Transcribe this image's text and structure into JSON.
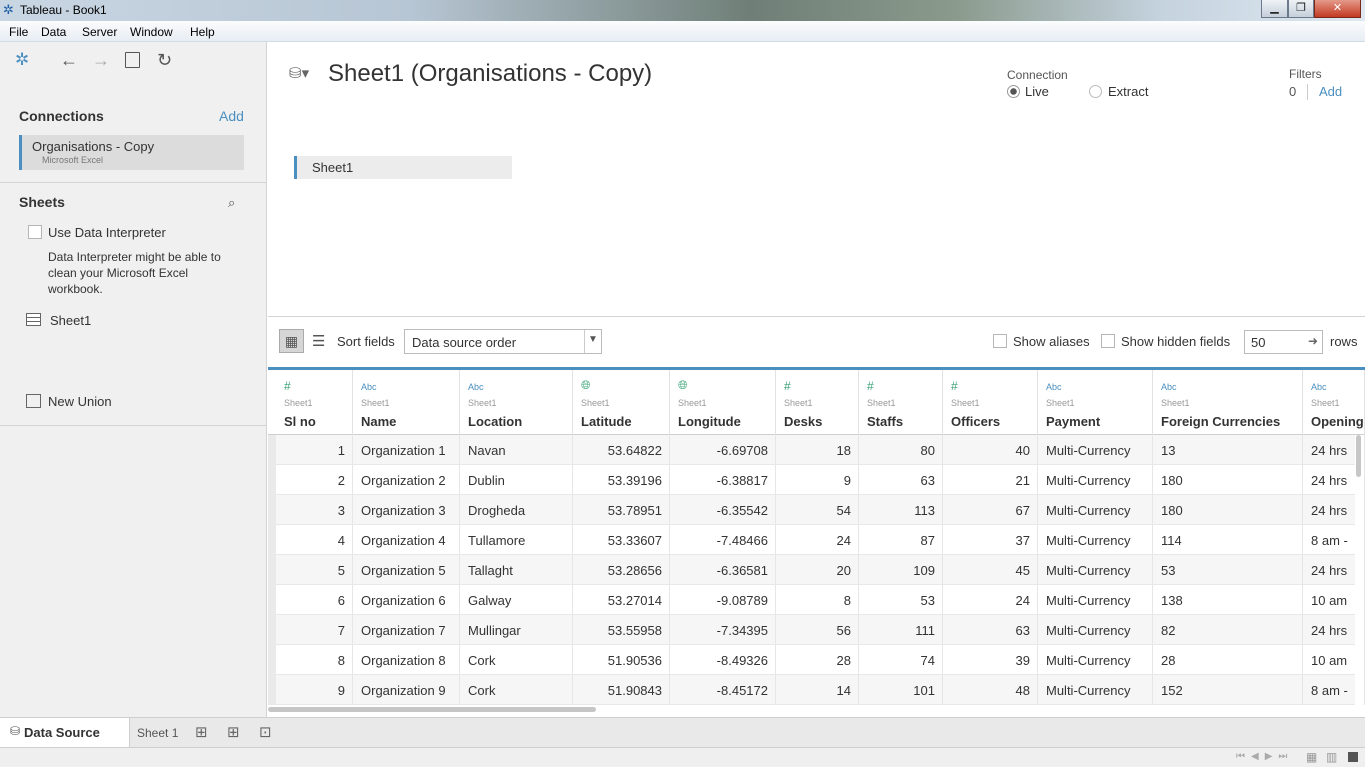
{
  "window": {
    "title": "Tableau - Book1"
  },
  "menu": [
    "File",
    "Data",
    "Server",
    "Window",
    "Help"
  ],
  "left": {
    "connections_title": "Connections",
    "connections_add": "Add",
    "connection": {
      "name": "Organisations - Copy",
      "type": "Microsoft Excel"
    },
    "sheets_title": "Sheets",
    "use_interpreter": "Use Data Interpreter",
    "interpreter_note": "Data Interpreter might be able to clean your Microsoft Excel workbook.",
    "sheet": "Sheet1",
    "new_union": "New Union"
  },
  "header": {
    "title": "Sheet1 (Organisations - Copy)",
    "connection_label": "Connection",
    "live": "Live",
    "extract": "Extract",
    "filters_label": "Filters",
    "filters_count": "0",
    "filters_add": "Add"
  },
  "canvas": {
    "sheet_pill": "Sheet1"
  },
  "toolbar": {
    "sort_label": "Sort fields",
    "sort_value": "Data source order",
    "show_aliases": "Show aliases",
    "show_hidden": "Show hidden fields",
    "rows_value": "50",
    "rows_label": "rows"
  },
  "grid": {
    "columns": [
      {
        "type": "#",
        "src": "Sheet1",
        "name": "Sl no"
      },
      {
        "type": "Abc",
        "src": "Sheet1",
        "name": "Name"
      },
      {
        "type": "Abc",
        "src": "Sheet1",
        "name": "Location"
      },
      {
        "type": "geo",
        "src": "Sheet1",
        "name": "Latitude"
      },
      {
        "type": "geo",
        "src": "Sheet1",
        "name": "Longitude"
      },
      {
        "type": "#",
        "src": "Sheet1",
        "name": "Desks"
      },
      {
        "type": "#",
        "src": "Sheet1",
        "name": "Staffs"
      },
      {
        "type": "#",
        "src": "Sheet1",
        "name": "Officers"
      },
      {
        "type": "Abc",
        "src": "Sheet1",
        "name": "Payment"
      },
      {
        "type": "Abc",
        "src": "Sheet1",
        "name": "Foreign Currencies"
      },
      {
        "type": "Abc",
        "src": "Sheet1",
        "name": "Opening H"
      }
    ],
    "rows": [
      [
        "1",
        "Organization 1",
        "Navan",
        "53.64822",
        "-6.69708",
        "18",
        "80",
        "40",
        "Multi-Currency",
        "13",
        "24 hrs"
      ],
      [
        "2",
        "Organization 2",
        "Dublin",
        "53.39196",
        "-6.38817",
        "9",
        "63",
        "21",
        "Multi-Currency",
        "180",
        "24 hrs"
      ],
      [
        "3",
        "Organization 3",
        "Drogheda",
        "53.78951",
        "-6.35542",
        "54",
        "113",
        "67",
        "Multi-Currency",
        "180",
        "24 hrs"
      ],
      [
        "4",
        "Organization 4",
        "Tullamore",
        "53.33607",
        "-7.48466",
        "24",
        "87",
        "37",
        "Multi-Currency",
        "114",
        "8 am -"
      ],
      [
        "5",
        "Organization 5",
        "Tallaght",
        "53.28656",
        "-6.36581",
        "20",
        "109",
        "45",
        "Multi-Currency",
        "53",
        "24 hrs"
      ],
      [
        "6",
        "Organization 6",
        "Galway",
        "53.27014",
        "-9.08789",
        "8",
        "53",
        "24",
        "Multi-Currency",
        "138",
        "10 am"
      ],
      [
        "7",
        "Organization 7",
        "Mullingar",
        "53.55958",
        "-7.34395",
        "56",
        "111",
        "63",
        "Multi-Currency",
        "82",
        "24 hrs"
      ],
      [
        "8",
        "Organization 8",
        "Cork",
        "51.90536",
        "-8.49326",
        "28",
        "74",
        "39",
        "Multi-Currency",
        "28",
        "10 am"
      ],
      [
        "9",
        "Organization 9",
        "Cork",
        "51.90843",
        "-8.45172",
        "14",
        "101",
        "48",
        "Multi-Currency",
        "152",
        "8 am -"
      ]
    ]
  },
  "tabs": {
    "data_source": "Data Source",
    "sheet1": "Sheet 1"
  }
}
